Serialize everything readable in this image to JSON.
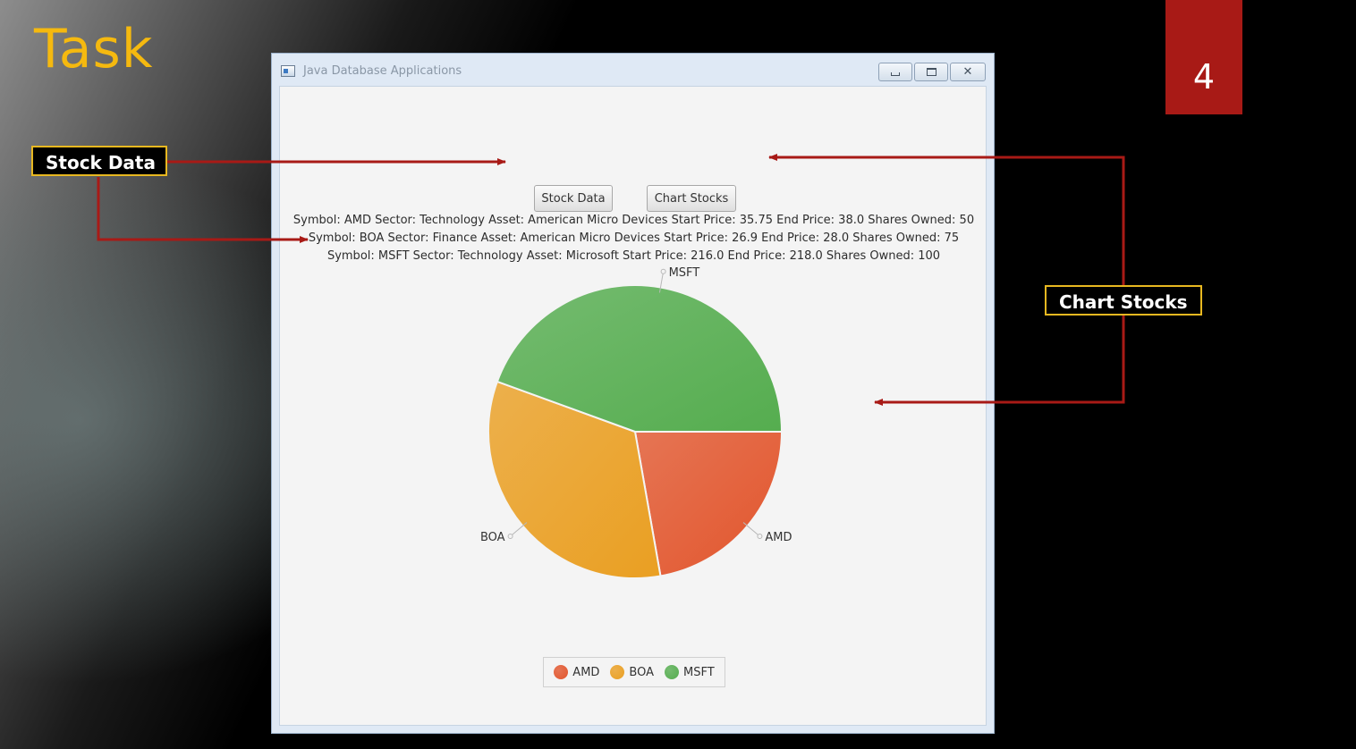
{
  "slide": {
    "title": "Task",
    "number": "4",
    "callouts": {
      "stock_data": "Stock Data",
      "chart_stocks": "Chart Stocks"
    }
  },
  "window": {
    "title": "Java Database Applications",
    "buttons": {
      "stock_data": "Stock Data",
      "chart_stocks": "Chart Stocks"
    },
    "stock_lines": [
      "Symbol: AMD Sector: Technology Asset: American Micro Devices Start Price: 35.75 End Price: 38.0 Shares Owned: 50",
      "Symbol: BOA Sector: Finance Asset: American Micro Devices Start Price: 26.9 End Price: 28.0 Shares Owned: 75",
      "Symbol: MSFT Sector: Technology Asset: Microsoft Start Price: 216.0 End Price: 218.0 Shares Owned: 100"
    ]
  },
  "colors": {
    "accent_title": "#f5b90f",
    "slide_number_bg": "#a81a16",
    "arrow": "#a81a16",
    "amd": "#e2552c",
    "boa": "#ea9f22",
    "msft": "#55ad4f"
  },
  "chart_data": {
    "type": "pie",
    "categories": [
      "AMD",
      "BOA",
      "MSFT"
    ],
    "values": [
      50,
      75,
      100
    ],
    "start_angle_deg": 0,
    "direction": "clockwise",
    "legend": "bottom",
    "legend_entries": [
      "AMD",
      "BOA",
      "MSFT"
    ]
  }
}
